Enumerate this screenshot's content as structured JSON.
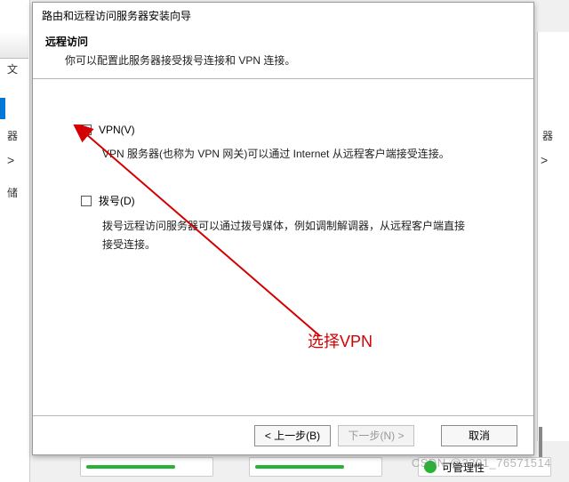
{
  "bg": {
    "label_wen": "文",
    "label_qi": "器",
    "label_chu": "储",
    "card_text": "可管理性",
    "label_qi2": "器"
  },
  "dialog": {
    "title": "路由和远程访问服务器安装向导",
    "header_title": "远程访问",
    "header_subtitle": "你可以配置此服务器接受拨号连接和 VPN 连接。",
    "vpn": {
      "label": "VPN(V)",
      "desc": "VPN 服务器(也称为 VPN 网关)可以通过 Internet 从远程客户端接受连接。"
    },
    "dial": {
      "label": "拨号(D)",
      "desc": "拨号远程访问服务器可以通过拨号媒体，例如调制解调器，从远程客户端直接接受连接。"
    },
    "buttons": {
      "back": "< 上一步(B)",
      "next": "下一步(N) >",
      "cancel": "取消"
    }
  },
  "annotation": "选择VPN",
  "watermark": "CSDN @2301_76571514"
}
